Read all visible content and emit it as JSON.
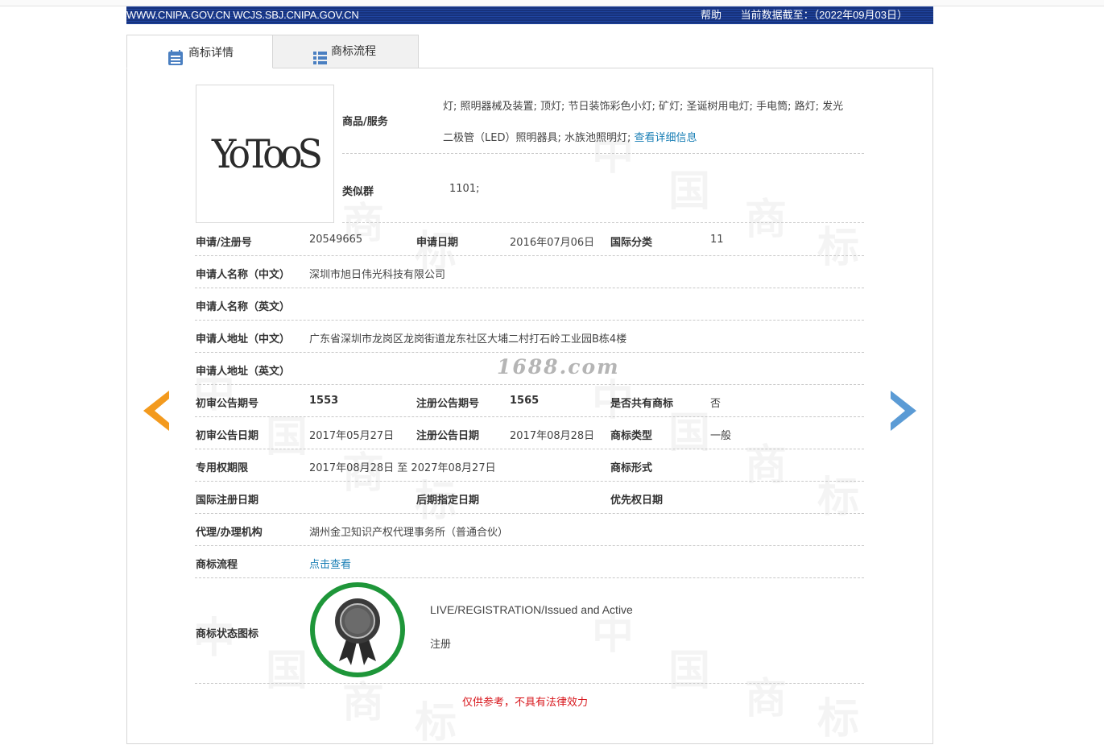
{
  "header": {
    "sites": "WWW.CNIPA.GOV.CN WCJS.SBJ.CNIPA.GOV.CN",
    "help": "帮助",
    "data_date": "当前数据截至：（2022年09月03日）"
  },
  "tabs": [
    {
      "label": "商标详情",
      "active": true
    },
    {
      "label": "商标流程",
      "active": false
    }
  ],
  "trademark": {
    "logo_text": "YoTooS",
    "goods_label": "商品/服务",
    "goods_line1": "灯; 照明器械及装置; 顶灯; 节日装饰彩色小灯; 矿灯; 圣诞树用电灯; 手电筒; 路灯; 发光",
    "goods_line2": "二极管（LED）照明器具; 水族池照明灯;",
    "goods_more": "查看详细信息",
    "similar_label": "类似群",
    "similar_value": "1101;",
    "reg_no_label": "申请/注册号",
    "reg_no": "20549665",
    "app_date_label": "申请日期",
    "app_date": "2016年07月06日",
    "intl_class_label": "国际分类",
    "intl_class": "11",
    "applicant_cn_label": "申请人名称（中文）",
    "applicant_cn": "深圳市旭日伟光科技有限公司",
    "applicant_en_label": "申请人名称（英文）",
    "applicant_en": "",
    "address_cn_label": "申请人地址（中文）",
    "address_cn": "广东省深圳市龙岗区龙岗街道龙东社区大埔二村打石岭工业园B栋4楼",
    "address_en_label": "申请人地址（英文）",
    "address_en": "",
    "prelim_no_label": "初审公告期号",
    "prelim_no": "1553",
    "reg_notice_no_label": "注册公告期号",
    "reg_notice_no": "1565",
    "shared_label": "是否共有商标",
    "shared": "否",
    "prelim_date_label": "初审公告日期",
    "prelim_date": "2017年05月27日",
    "reg_notice_date_label": "注册公告日期",
    "reg_notice_date": "2017年08月28日",
    "tm_type_label": "商标类型",
    "tm_type": "一般",
    "exclusive_label": "专用权期限",
    "exclusive": "2017年08月28日 至 2027年08月27日",
    "tm_form_label": "商标形式",
    "tm_form": "",
    "intl_reg_date_label": "国际注册日期",
    "intl_reg_date": "",
    "later_date_label": "后期指定日期",
    "later_date": "",
    "priority_label": "优先权日期",
    "priority": "",
    "agent_label": "代理/办理机构",
    "agent": "湖州金卫知识产权代理事务所（普通合伙）",
    "process_label": "商标流程",
    "process_link": "点击查看",
    "status_icon_label": "商标状态图标",
    "status_en": "LIVE/REGISTRATION/Issued and Active",
    "status_cn": "注册"
  },
  "disclaimer": "仅供参考，不具有法律效力",
  "overlay_site": "1688.com",
  "watermark_chars": [
    "中",
    "国",
    "商",
    "标"
  ],
  "colors": {
    "header_blue": "#1a3a8e",
    "link_blue": "#1a7fb5",
    "prev_arrow": "#f39a1e",
    "next_arrow": "#5b9bd5",
    "badge_green": "#1e9639",
    "disclaimer_red": "#d7141a"
  },
  "icons": {
    "tab_details": "document-list-icon",
    "tab_process": "grid-list-icon",
    "prev": "chevron-left-icon",
    "next": "chevron-right-icon",
    "status": "award-ribbon-icon"
  }
}
